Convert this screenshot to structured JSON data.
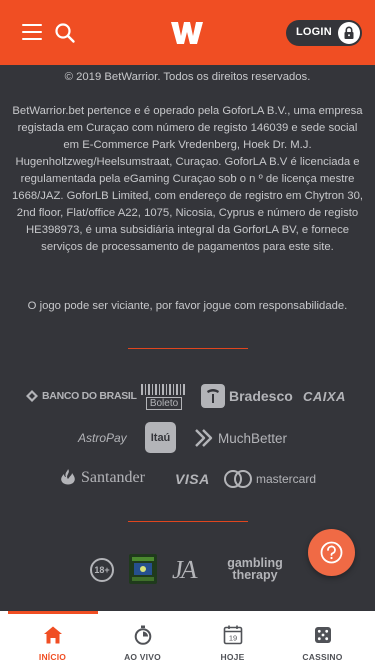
{
  "header": {
    "login_label": "LOGIN",
    "brand_color": "#f04e23",
    "icons": [
      "hamburger-menu-icon",
      "search-icon",
      "betwarrior-logo",
      "lock-icon"
    ]
  },
  "footer": {
    "copyright": "© 2019 BetWarrior. Todos os direitos reservados.",
    "legal": "BetWarrior.bet pertence e é operado pela GoforLA B.V., uma empresa registada em Curaçao com número de registo 146039 e sede social em E-Commerce Park Vredenberg, Hoek Dr. M.J. Hugenholtzweg/Heelsumstraat, Curaçao. GoforLA B.V é licenciada e regulamentada pela eGaming Curaçao sob o n º de licença mestre 1668/JAZ. GoforLB Limited, com endereço de registro em Chytron 30, 2nd floor, Flat/office A22, 1075, Nicosia, Cyprus e número de registo HE398973, é uma subsidiária integral da GorforLA BV, e fornece serviços de processamento de pagamentos para este site.",
    "responsible": "O jogo pode ser viciante, por favor jogue com responsabilidade."
  },
  "payments": {
    "banco_do_brasil": "BANCO DO BRASIL",
    "boleto": "Boleto",
    "bradesco": "Bradesco",
    "caixa": "CAIXA",
    "astropay": "AstroPay",
    "itau": "Itaú",
    "muchbetter": "MuchBetter",
    "santander": "Santander",
    "visa": "VISA",
    "mastercard": "mastercard"
  },
  "compliance": {
    "age": "18+",
    "ja": "JA",
    "gambling_therapy": "gambling therapy"
  },
  "bottom_nav": [
    {
      "label": "INÍCIO",
      "icon": "home-icon",
      "active": true
    },
    {
      "label": "AO VIVO",
      "icon": "stopwatch-icon",
      "active": false
    },
    {
      "label": "HOJE",
      "icon": "calendar-icon",
      "active": false,
      "day": "19"
    },
    {
      "label": "CASSINO",
      "icon": "dice-icon",
      "active": false
    }
  ]
}
